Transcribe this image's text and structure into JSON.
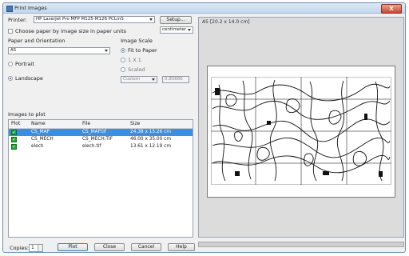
{
  "window": {
    "title": "Print Images",
    "close_glyph": "X"
  },
  "printer": {
    "label": "Printer:",
    "value": "HP LaserJet Pro MFP M125-M126 PCLmS",
    "setup_label": "Setup..."
  },
  "paper_options": {
    "choose_by_size_label": "Choose paper by image size in paper units",
    "choose_by_size_checked": false,
    "units_value": "centimeter"
  },
  "paper_orientation": {
    "heading": "Paper and Orientation",
    "paper_value": "A5",
    "portrait_label": "Portrait",
    "landscape_label": "Landscape",
    "selected": "landscape"
  },
  "image_scale": {
    "heading": "Image Scale",
    "fit_label": "Fit to Paper",
    "one_to_one_label": "1 X 1",
    "scaled_label": "Scaled",
    "selected": "fit",
    "scaled_unit_value": "Custom",
    "scaled_factor_value": "0.85666"
  },
  "images_to_plot": {
    "heading": "Images to plot",
    "columns": [
      "Plot",
      "Name",
      "File",
      "Size"
    ],
    "rows": [
      {
        "plot": true,
        "name": "CS_MAP",
        "file": "CS_MAP.tif",
        "size": "24.38 x 15.26 cm",
        "selected": true
      },
      {
        "plot": true,
        "name": "CS_MECH",
        "file": "CS_MECH.TIF",
        "size": "46.00 x 35.00 cm",
        "selected": false
      },
      {
        "plot": true,
        "name": "elech",
        "file": "elech.tif",
        "size": "13.61 x 12.19 cm",
        "selected": false
      }
    ]
  },
  "preview": {
    "title": "A5 [20.2 x 14.0 cm]"
  },
  "footer": {
    "copies_label": "Copies:",
    "copies_value": "1",
    "plot_label": "Plot",
    "close_label": "Close",
    "cancel_label": "Cancel",
    "help_label": "Help"
  }
}
